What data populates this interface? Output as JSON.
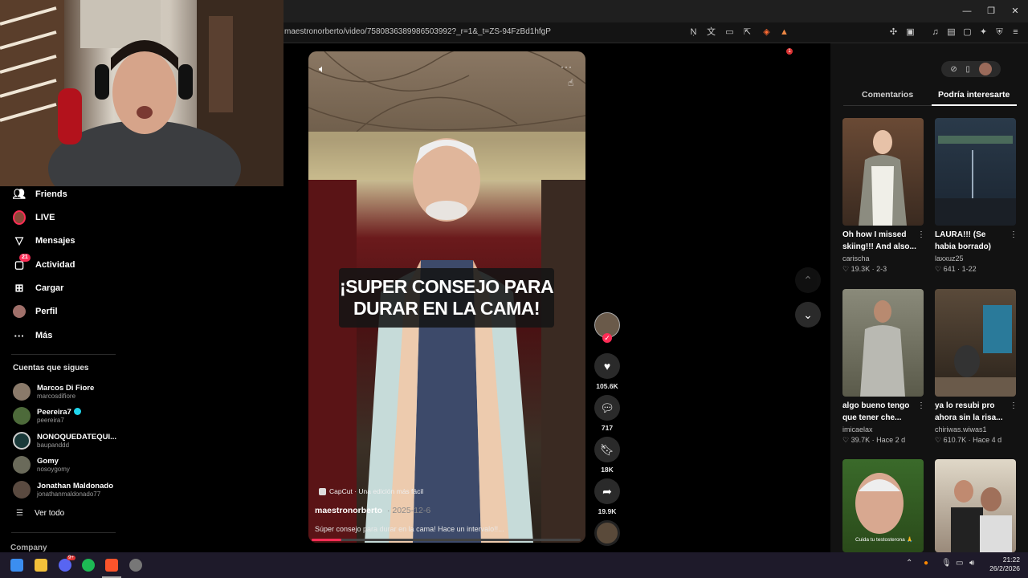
{
  "browser": {
    "url": "maestronorberto/video/7580836389986503992?_r=1&_t=ZS-94FzBd1hfgP",
    "shields_count": "",
    "alerts_count": "1"
  },
  "sidebar": {
    "nav": [
      {
        "label": "Friends",
        "icon": "friends-icon"
      },
      {
        "label": "LIVE",
        "icon": "live-icon"
      },
      {
        "label": "Mensajes",
        "icon": "messages-icon"
      },
      {
        "label": "Actividad",
        "icon": "activity-icon",
        "badge": "21"
      },
      {
        "label": "Cargar",
        "icon": "upload-icon"
      },
      {
        "label": "Perfil",
        "icon": "profile-icon"
      },
      {
        "label": "Más",
        "icon": "more-icon"
      }
    ],
    "following_heading": "Cuentas que sigues",
    "accounts": [
      {
        "name": "Marcos Di Fiore",
        "user": "marcosdifiore"
      },
      {
        "name": "Peereira7",
        "user": "peereira7",
        "verified": true
      },
      {
        "name": "NONOQUEDATEQUI...",
        "user": "baupanddd"
      },
      {
        "name": "Gomy",
        "user": "nosoygomy"
      },
      {
        "name": "Jonathan Maldonado",
        "user": "jonathanmaldonado77"
      }
    ],
    "see_all": "Ver todo",
    "company": "Company"
  },
  "video": {
    "caption_line1": "¡SUPER CONSEJO PARA",
    "caption_line2": "DURAR EN LA CAMA!",
    "capcut": "CapCut · Una edición más fácil",
    "author": "maestronorberto",
    "date": "· 2025-12-6",
    "description": "Súper consejo para durar en la cama! Hace un intervalo!!...",
    "progress": 0.11
  },
  "actions": {
    "likes": "105.6K",
    "comments": "717",
    "saves": "18K",
    "shares": "19.9K"
  },
  "right_panel": {
    "tabs": [
      "Comentarios",
      "Podría interesarte"
    ],
    "active_tab": "Podría interesarte",
    "cards": [
      {
        "title": "Oh how I missed skiing!!! And also...",
        "user": "carischa",
        "likes": "19.3K",
        "date": "2-3"
      },
      {
        "title": "LAURA!!! (Se habia borrado)",
        "user": "laxxuz25",
        "likes": "641",
        "date": "1-22"
      },
      {
        "title": "algo bueno tengo que tener che...",
        "user": "imicaelax",
        "likes": "39.7K",
        "date": "Hace 2 d"
      },
      {
        "title": "ya lo resubi pro ahora sin la risa...",
        "user": "chiriwas.wiwas1",
        "likes": "610.7K",
        "date": "Hace 4 d"
      }
    ],
    "thumb_overlay_5": "Cuida tu testosterona 🙏"
  },
  "taskbar": {
    "time": "21:22",
    "date": "26/2/2026",
    "discord_badge": "9+"
  }
}
